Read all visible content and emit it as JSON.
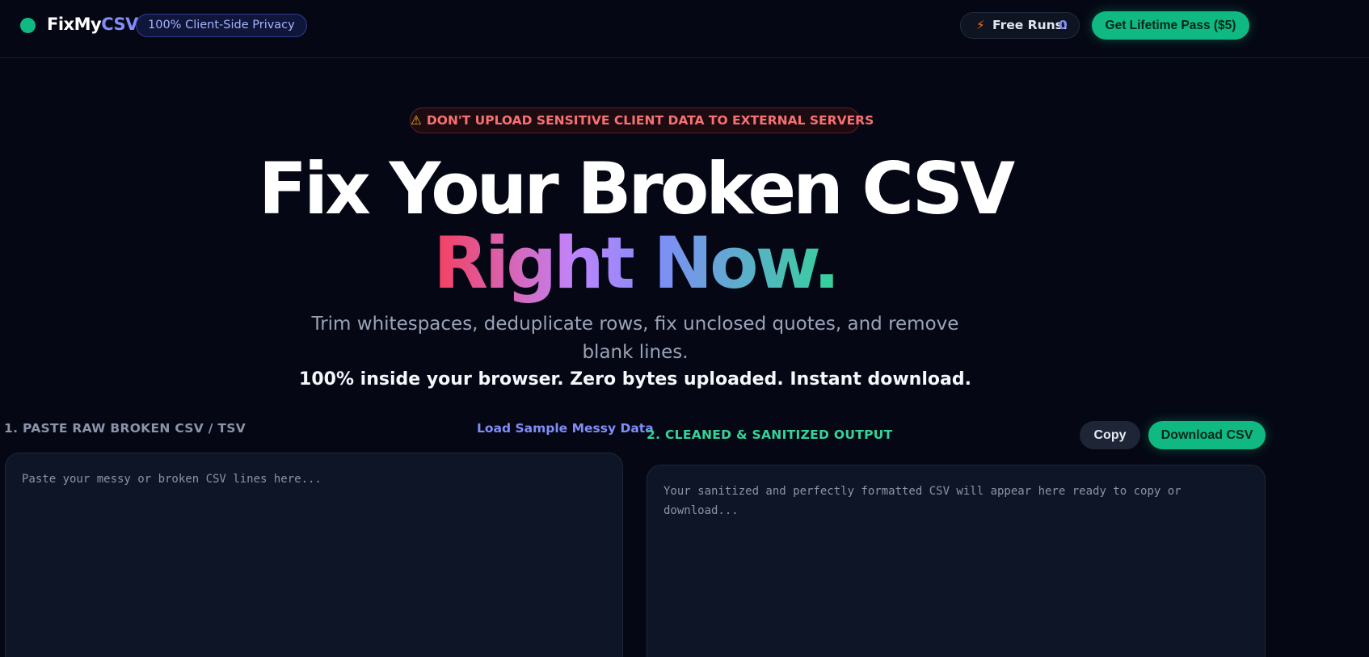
{
  "header": {
    "brand_main": "FixMy",
    "brand_accent": "CSV",
    "privacy_badge": "100% Client-Side Privacy",
    "free_runs_label": "Free Runs:",
    "free_runs_count": "0",
    "lifetime_button": "Get Lifetime Pass ($5)"
  },
  "warning": {
    "icon": "warning-icon",
    "text": "DON'T UPLOAD SENSITIVE CLIENT DATA TO EXTERNAL SERVERS"
  },
  "hero": {
    "title": "Fix Your Broken CSV",
    "subtitle": "Right Now.",
    "description": "Trim whitespaces, deduplicate rows, fix unclosed quotes, and remove blank lines.",
    "strong_line": "100% inside your browser. Zero bytes uploaded. Instant download."
  },
  "input_panel": {
    "label": "1. PASTE RAW BROKEN CSV / TSV",
    "sample_link": "Load Sample Messy Data",
    "placeholder": "Paste your messy or broken CSV lines here..."
  },
  "output_panel": {
    "label": "2. CLEANED & SANITIZED OUTPUT",
    "copy_button": "Copy",
    "download_button": "Download CSV",
    "placeholder": "Your sanitized and perfectly formatted CSV will appear here ready to copy or download..."
  },
  "colors": {
    "accent_green": "#10b981",
    "accent_indigo": "#818cf8",
    "warning_red": "#f87171",
    "background": "#050814"
  }
}
